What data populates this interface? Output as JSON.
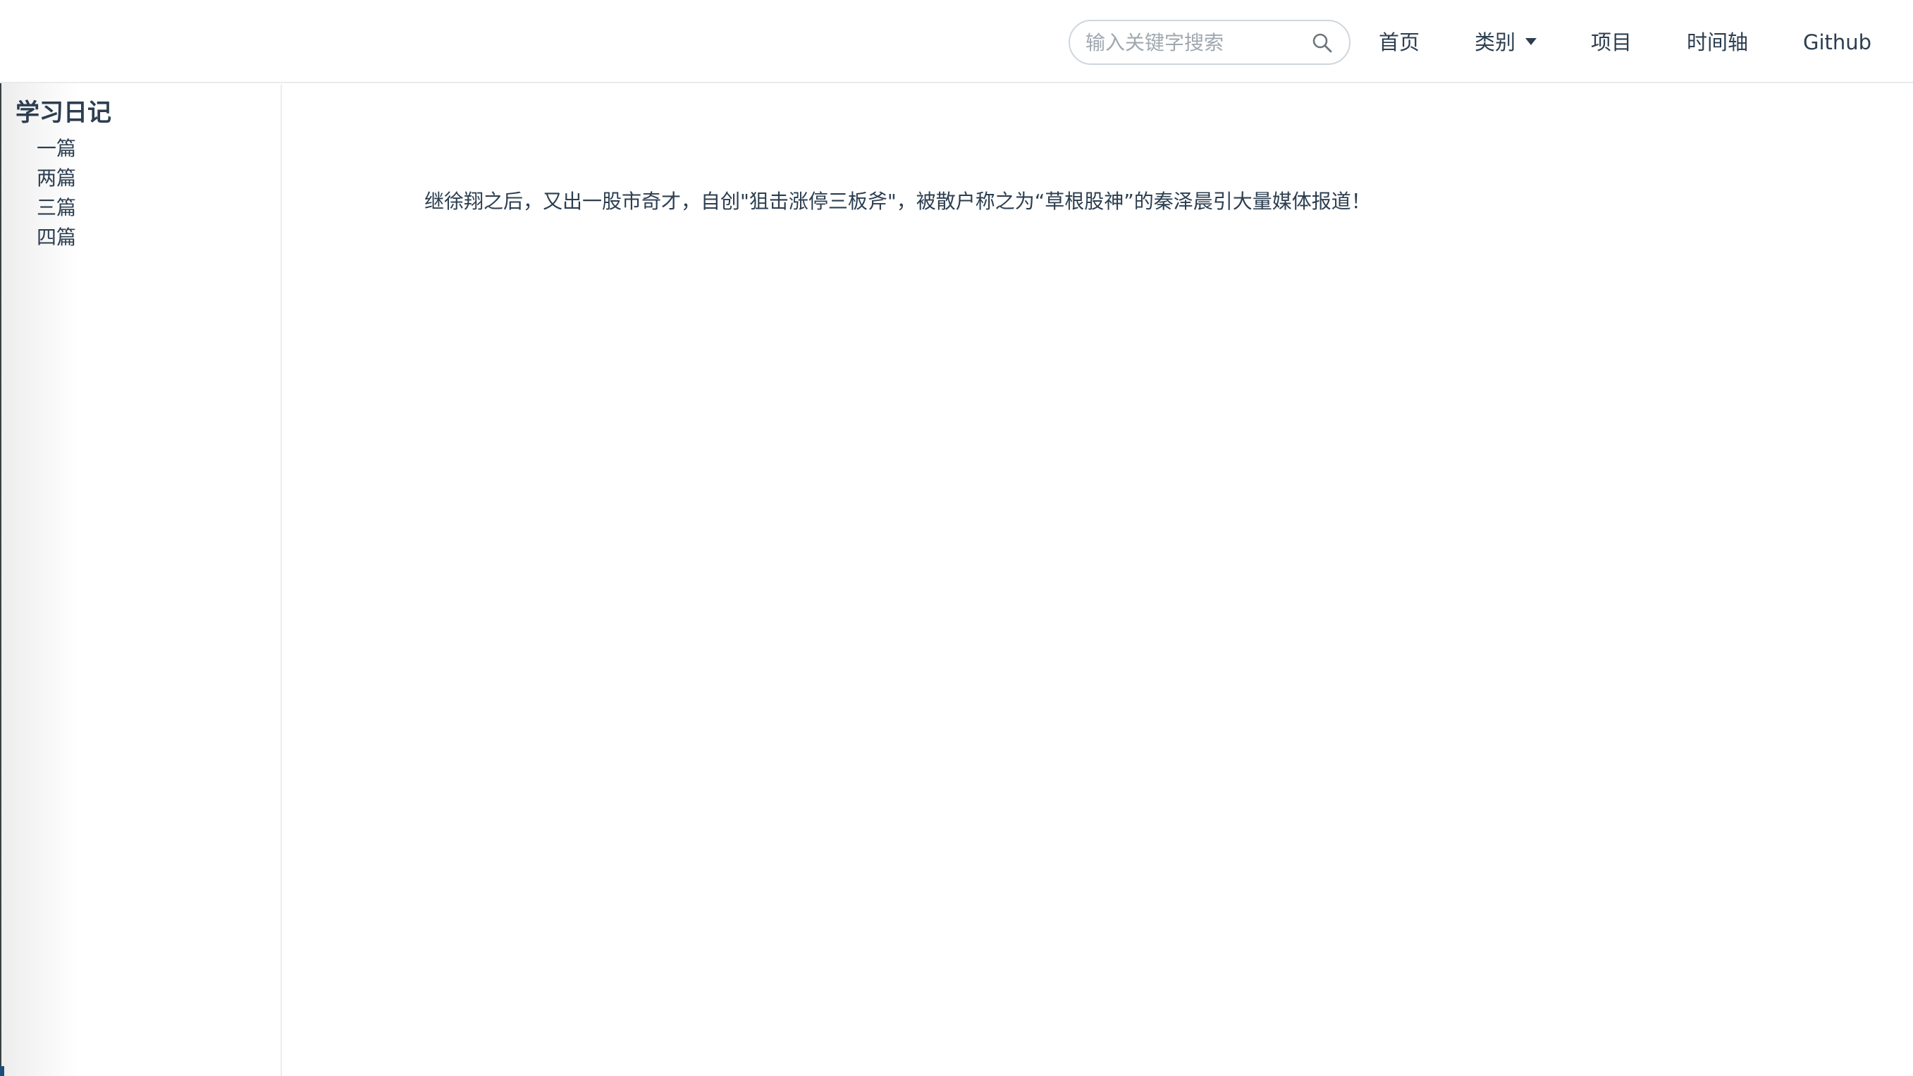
{
  "navbar": {
    "search": {
      "placeholder": "输入关键字搜索",
      "value": "",
      "icon": "search-icon"
    },
    "links": {
      "home": "首页",
      "category": "类别",
      "projects": "项目",
      "timeline": "时间轴",
      "github": "Github"
    }
  },
  "sidebar": {
    "title": "学习日记",
    "items": [
      "一篇",
      "两篇",
      "三篇",
      "四篇"
    ]
  },
  "main": {
    "text": "继徐翔之后，又出一股市奇才，自创\"狙击涨停三板斧\"，被散户称之为“草根股神”的秦泽晨引大量媒体报道！"
  },
  "colors": {
    "text": "#2c3e50",
    "border": "#e9ecef",
    "search_border": "#cfd6dd",
    "placeholder": "#a0a8b0"
  }
}
